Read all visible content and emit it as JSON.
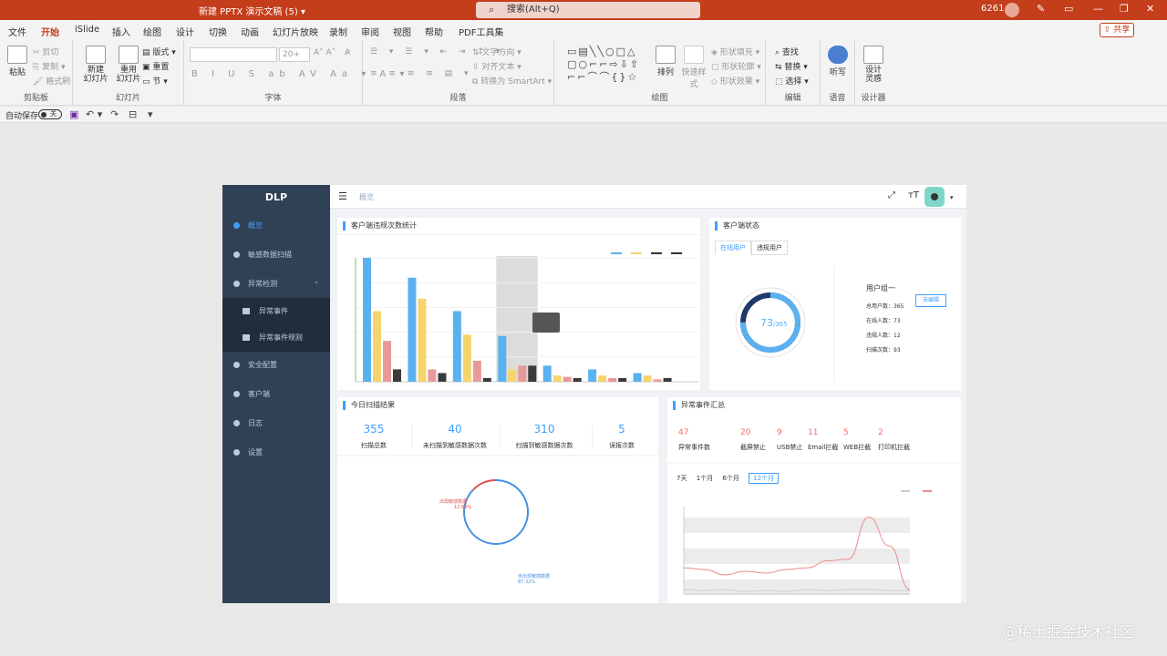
{
  "window": {
    "title": "新建 PPTX 演示文稿 (5)  ▾",
    "search": "搜索(Alt+Q)",
    "user_id": "6261",
    "share": "共享"
  },
  "menu": [
    "文件",
    "开始",
    "iSlide",
    "插入",
    "绘图",
    "设计",
    "切换",
    "动画",
    "幻灯片放映",
    "录制",
    "审阅",
    "视图",
    "帮助",
    "PDF工具集"
  ],
  "menu_active": "开始",
  "ribbon": {
    "paste": "粘贴",
    "cut": "剪切",
    "copy": "复制",
    "format_painter": "格式刷",
    "group_clipboard": "剪贴板",
    "new_slide": "新建\n幻灯片",
    "reuse_slide": "重用\n幻灯片",
    "layout": "版式",
    "reset": "重置",
    "section": "节",
    "group_slides": "幻灯片",
    "font_size": "20+",
    "group_font": "字体",
    "text_direction": "文字方向",
    "align_text": "对齐文本",
    "smartart": "转换为 SmartArt",
    "group_paragraph": "段落",
    "arrange": "排列",
    "quick_styles": "快速样式",
    "shape_fill": "形状填充",
    "shape_outline": "形状轮廓",
    "shape_effects": "形状效果",
    "group_drawing": "绘图",
    "find": "查找",
    "replace": "替换",
    "select": "选择",
    "group_editing": "编辑",
    "dictate": "听写",
    "group_voice": "语音",
    "designer": "设计\n灵感",
    "group_designer": "设计器"
  },
  "qat": {
    "autosave": "自动保存",
    "toggle": "关"
  },
  "app": {
    "logo": "DLP",
    "breadcrumb": "概览",
    "nav": [
      {
        "label": "概览",
        "active": true
      },
      {
        "label": "敏感数据扫描"
      },
      {
        "label": "异常检测",
        "expanded": true
      },
      {
        "label": "异常事件",
        "sub": true
      },
      {
        "label": "异常事件规则",
        "sub": true
      },
      {
        "label": "安全配置"
      },
      {
        "label": "客户端"
      },
      {
        "label": "日志"
      },
      {
        "label": "设置"
      }
    ]
  },
  "panels": {
    "violation_title": "客户端违规次数统计",
    "client_status_title": "客户端状态",
    "client_tabs": [
      "在线用户",
      "违规用户"
    ],
    "gauge": {
      "value": 73,
      "total": 365,
      "text_main": "73",
      "text_sub": "/365"
    },
    "group": {
      "title": "用户组一",
      "edit": "去编辑",
      "lines": [
        "总用户数：365",
        "在线人数：73",
        "违规人数：12",
        "扫描次数：93"
      ]
    },
    "scan_title": "今日扫描结果",
    "scan_stats": [
      {
        "num": "355",
        "label": "扫描总数"
      },
      {
        "num": "40",
        "label": "未扫描到敏感数据次数"
      },
      {
        "num": "310",
        "label": "扫描到敏感数据次数"
      },
      {
        "num": "5",
        "label": "误报次数"
      }
    ],
    "pie_labels": [
      {
        "text": "出现敏感数据",
        "pct": "12.68%"
      },
      {
        "text": "未出现敏感数据",
        "pct": "87.32%"
      }
    ],
    "alarm_title": "异常事件汇总",
    "alarms": [
      {
        "num": "47",
        "label": "异常事件数"
      },
      {
        "num": "20",
        "label": "截屏禁止"
      },
      {
        "num": "9",
        "label": "USB禁止"
      },
      {
        "num": "11",
        "label": "Email拦截"
      },
      {
        "num": "5",
        "label": "WEB拦截"
      },
      {
        "num": "2",
        "label": "打印机拦截"
      }
    ],
    "period_tabs": [
      "7天",
      "1个月",
      "6个月",
      "12个月"
    ],
    "period_active": "12个月"
  },
  "colors": {
    "ppt_red": "#c43e1c",
    "sidebar": "#304156",
    "accent": "#409eff",
    "bar_blue": "#5ab1ef",
    "bar_yellow": "#f5d46b",
    "bar_pink": "#e89a9a",
    "bar_dark": "#3a3a3a",
    "line_red": "#ef8a8a"
  },
  "chart_data": [
    {
      "type": "bar",
      "categories": [
        "",
        "",
        "",
        "",
        "",
        "",
        ""
      ],
      "series": [
        {
          "values": [
            100,
            84,
            57,
            37,
            13,
            10,
            7
          ]
        },
        {
          "values": [
            57,
            67,
            38,
            10,
            5,
            5,
            5
          ]
        },
        {
          "values": [
            33,
            10,
            17,
            13,
            4,
            3,
            2
          ]
        },
        {
          "values": [
            10,
            7,
            3,
            13,
            3,
            3,
            3
          ]
        }
      ],
      "highlight_index": 3
    },
    {
      "type": "pie",
      "values": [
        12.68,
        87.32
      ],
      "labels": [
        "出现敏感数据",
        "未出现敏感数据"
      ]
    },
    {
      "type": "line",
      "x": [
        1,
        2,
        3,
        4,
        5,
        6,
        7,
        8,
        9,
        10,
        11,
        12
      ],
      "series": [
        {
          "values": [
            30,
            28,
            22,
            26,
            24,
            28,
            30,
            38,
            40,
            88,
            55,
            5
          ]
        },
        {
          "values": [
            5,
            4,
            5,
            3,
            4,
            3,
            5,
            4,
            5,
            5,
            4,
            4
          ]
        }
      ]
    }
  ]
}
